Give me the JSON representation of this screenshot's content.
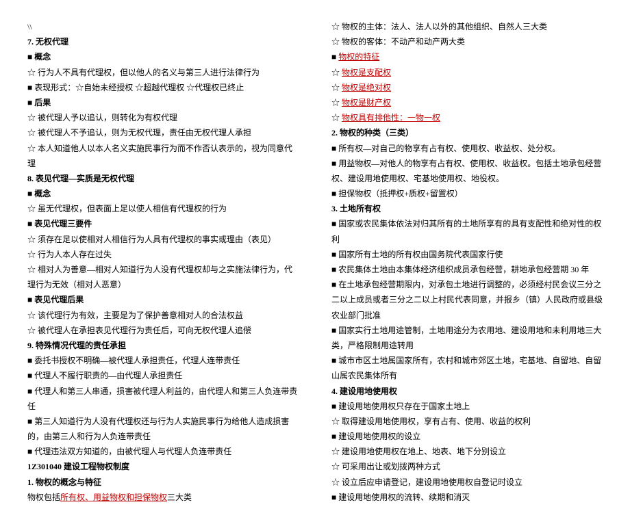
{
  "left": [
    {
      "t": "\\\\",
      "c": ""
    },
    {
      "t": "7.  无权代理",
      "c": "bold"
    },
    {
      "t": "■  概念",
      "c": "bold"
    },
    {
      "t": "☆  行为人不具有代理权，但以他人的名义与第三人进行法律行为",
      "c": ""
    },
    {
      "t": "■  表现形式：☆自始未经授权   ☆超越代理权   ☆代理权已终止",
      "c": ""
    },
    {
      "t": "■  后果",
      "c": "bold"
    },
    {
      "t": "☆  被代理人予以追认，则转化为有权代理",
      "c": ""
    },
    {
      "t": "☆  被代理人不予追认，则为无权代理，责任由无权代理人承担",
      "c": ""
    },
    {
      "t": "☆  本人知道他人以本人名义实施民事行为而不作否认表示的，视为同意代理",
      "c": ""
    },
    {
      "t": "8.  表见代理—实质是无权代理",
      "c": "bold"
    },
    {
      "t": "■  概念",
      "c": "bold"
    },
    {
      "t": "☆  虽无代理权，但表面上足以使人相信有代理权的行为",
      "c": ""
    },
    {
      "t": "■  表见代理三要件",
      "c": "bold"
    },
    {
      "t": "☆  须存在足以使相对人相信行为人具有代理权的事实或理由（表见）",
      "c": ""
    },
    {
      "t": "☆  行为人本人存在过失",
      "c": ""
    },
    {
      "t": "☆  相对人为善意—相对人知道行为人没有代理权却与之实施法律行为，代理行为无效（相对人恶意）",
      "c": ""
    },
    {
      "t": "■  表见代理后果",
      "c": "bold"
    },
    {
      "t": "☆  该代理行为有效，主要是为了保护善意相对人的合法权益",
      "c": ""
    },
    {
      "t": "☆  被代理人在承担表见代理行为责任后，可向无权代理人追偿",
      "c": ""
    },
    {
      "t": "9.  特殊情况代理的责任承担",
      "c": "bold"
    },
    {
      "t": "■  委托书授权不明确—被代理人承担责任，代理人连带责任",
      "c": ""
    },
    {
      "t": "■  代理人不履行职责的—由代理人承担责任",
      "c": ""
    },
    {
      "t": "■  代理人和第三人串通，损害被代理人利益的，由代理人和第三人负连带责任",
      "c": ""
    },
    {
      "t": "■  第三人知道行为人没有代理权还与行为人实施民事行为给他人造成损害的，由第三人和行为人负连带责任",
      "c": ""
    },
    {
      "t": "■  代理违法双方知道的，由被代理人与代理人负连带责任",
      "c": ""
    },
    {
      "t": "1Z301040  建设工程物权制度",
      "c": "bold"
    },
    {
      "t": "1.  物权的概念与特征",
      "c": "bold"
    }
  ],
  "left_special_prefix": "物权包括",
  "left_special_red": "所有权、用益物权和担保物权",
  "left_special_suffix": "三大类",
  "right_plain1": [
    {
      "t": "☆  物权的主体：法人、法人以外的其他组织、自然人三大类",
      "c": ""
    },
    {
      "t": "☆  物权的客体：不动产和动产两大类",
      "c": ""
    }
  ],
  "right_red": [
    {
      "p": "■  ",
      "t": "物权的特征"
    },
    {
      "p": "☆  ",
      "t": "物权是支配权"
    },
    {
      "p": "☆  ",
      "t": "物权是绝对权"
    },
    {
      "p": "☆  ",
      "t": "物权是财产权"
    },
    {
      "p": "☆  ",
      "t": "物权具有排他性：一物一权"
    }
  ],
  "right_plain2": [
    {
      "t": "2.  物权的种类（三类）",
      "c": "bold"
    },
    {
      "t": "■  所有权—对自己的物享有占有权、使用权、收益权、处分权。",
      "c": ""
    },
    {
      "t": "■  用益物权—对他人的物享有占有权、使用权、收益权。包括土地承包经营权、建设用地使用权、宅基地使用权、地役权。",
      "c": ""
    },
    {
      "t": "■  担保物权（抵押权+质权+留置权）",
      "c": ""
    },
    {
      "t": "3.  土地所有权",
      "c": "bold"
    },
    {
      "t": "■  国家或农民集体依法对归其所有的土地所享有的具有支配性和绝对性的权利",
      "c": ""
    },
    {
      "t": "■  国家所有土地的所有权由国务院代表国家行使",
      "c": ""
    },
    {
      "t": "■  农民集体土地由本集体经济组织成员承包经营，耕地承包经营期 30 年",
      "c": ""
    },
    {
      "t": "■  在土地承包经营期限内，对承包土地进行调整的，必须经村民会议三分之二以上成员或者三分之二以上村民代表同意，并报乡（镇）人民政府或县级农业部门批准",
      "c": ""
    },
    {
      "t": "■  国家实行土地用途管制，土地用途分为农用地、建设用地和未利用地三大类，严格限制用途转用",
      "c": ""
    },
    {
      "t": "■  城市市区土地属国家所有，农村和城市郊区土地，宅基地、自留地、自留山属农民集体所有",
      "c": ""
    },
    {
      "t": "4.  建设用地使用权",
      "c": "bold"
    },
    {
      "t": "■  建设用地使用权只存在于国家土地上",
      "c": ""
    },
    {
      "t": "☆  取得建设用地使用权，享有占有、使用、收益的权利",
      "c": ""
    },
    {
      "t": "■  建设用地使用权的设立",
      "c": ""
    },
    {
      "t": "☆  建设用地使用权在地上、地表、地下分别设立",
      "c": ""
    },
    {
      "t": "☆  可采用出让或划拨两种方式",
      "c": ""
    },
    {
      "t": "☆  设立后应申请登记，建设用地使用权自登记时设立",
      "c": ""
    },
    {
      "t": "■  建设用地使用权的流转、续期和消灭",
      "c": ""
    }
  ]
}
